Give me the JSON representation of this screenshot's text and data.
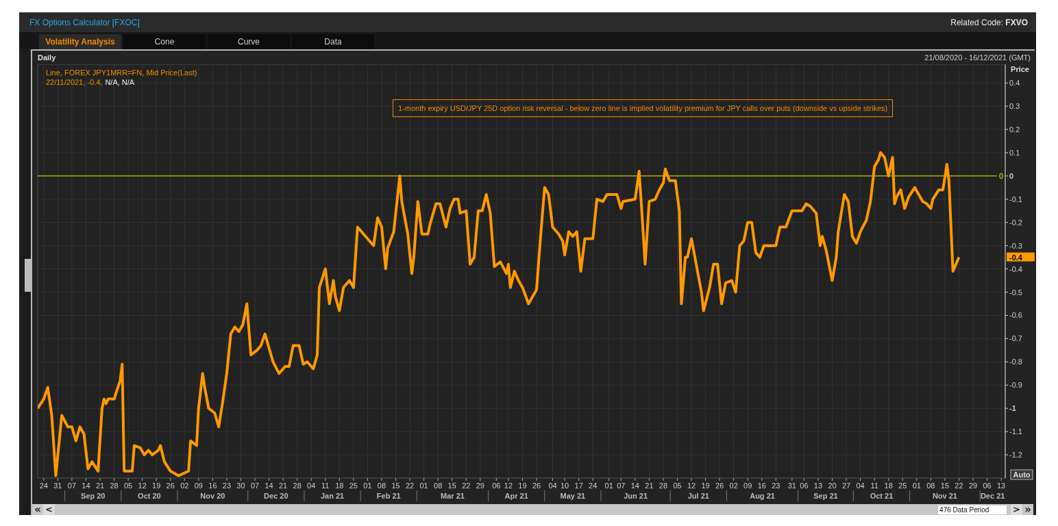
{
  "window": {
    "title": "FX Options Calculator [FXOC]",
    "related_code": "Related Code: **FXVO**"
  },
  "tabs": [
    {
      "label": "Volatility Analysis",
      "selected": true
    },
    {
      "label": "Cone",
      "selected": false
    },
    {
      "label": "Curve",
      "selected": false
    },
    {
      "label": "Data",
      "selected": false
    }
  ],
  "chart_panel": {
    "interval": "Daily",
    "date_range": "21/08/2020 - 16/12/2021 (GMT)",
    "legend": {
      "readout": [
        {
          "kind": "value",
          "text": "22/11/2021, -0.4,"
        },
        {
          "kind": "na",
          "text": "N/A, N/A"
        }
      ]
    },
    "auto_button": "Auto",
    "months": [
      "Sep 20",
      "Oct 20",
      "Nov 20",
      "Dec 20",
      "Jan 21",
      "Feb 21",
      "Mar 21",
      "Apr 21",
      "May 21",
      "Jun 21",
      "Jul 21",
      "Aug 21",
      "Sep 21",
      "Oct 21",
      "Nov 21",
      "Dec 21"
    ],
    "chart_data": {
      "type": "line",
      "ylabel": "Price",
      "x": [
        "2020-08-21",
        "2020-08-24",
        "2020-08-26",
        "2020-08-28",
        "2020-08-30",
        "2020-09-02",
        "2020-09-05",
        "2020-09-07",
        "2020-09-09",
        "2020-09-11",
        "2020-09-13",
        "2020-09-15",
        "2020-09-17",
        "2020-09-20",
        "2020-09-22",
        "2020-09-23",
        "2020-09-24",
        "2020-09-25",
        "2020-09-28",
        "2020-10-01",
        "2020-10-02",
        "2020-10-03",
        "2020-10-07",
        "2020-10-08",
        "2020-10-11",
        "2020-10-13",
        "2020-10-15",
        "2020-10-17",
        "2020-10-20",
        "2020-10-21",
        "2020-10-23",
        "2020-10-26",
        "2020-10-30",
        "2020-11-04",
        "2020-11-05",
        "2020-11-08",
        "2020-11-09",
        "2020-11-11",
        "2020-11-12",
        "2020-11-14",
        "2020-11-17",
        "2020-11-19",
        "2020-11-21",
        "2020-11-23",
        "2020-11-25",
        "2020-11-27",
        "2020-11-29",
        "2020-12-01",
        "2020-12-03",
        "2020-12-05",
        "2020-12-08",
        "2020-12-10",
        "2020-12-12",
        "2020-12-14",
        "2020-12-16",
        "2020-12-19",
        "2020-12-22",
        "2020-12-24",
        "2020-12-26",
        "2020-12-29",
        "2020-12-31",
        "2021-01-02",
        "2021-01-05",
        "2021-01-07",
        "2021-01-08",
        "2021-01-11",
        "2021-01-13",
        "2021-01-15",
        "2021-01-16",
        "2021-01-18",
        "2021-01-20",
        "2021-01-23",
        "2021-01-25",
        "2021-01-27",
        "2021-01-30",
        "2021-02-01",
        "2021-02-04",
        "2021-02-06",
        "2021-02-08",
        "2021-02-10",
        "2021-02-11",
        "2021-02-14",
        "2021-02-17",
        "2021-02-18",
        "2021-02-21",
        "2021-02-23",
        "2021-02-24",
        "2021-02-26",
        "2021-02-28",
        "2021-03-03",
        "2021-03-04",
        "2021-03-07",
        "2021-03-09",
        "2021-03-12",
        "2021-03-14",
        "2021-03-16",
        "2021-03-18",
        "2021-03-19",
        "2021-03-22",
        "2021-03-24",
        "2021-03-26",
        "2021-03-28",
        "2021-03-30",
        "2021-04-01",
        "2021-04-03",
        "2021-04-05",
        "2021-04-08",
        "2021-04-11",
        "2021-04-12",
        "2021-04-13",
        "2021-04-15",
        "2021-04-17",
        "2021-04-19",
        "2021-04-22",
        "2021-04-24",
        "2021-04-26",
        "2021-04-28",
        "2021-04-30",
        "2021-05-02",
        "2021-05-04",
        "2021-05-07",
        "2021-05-09",
        "2021-05-10",
        "2021-05-12",
        "2021-05-14",
        "2021-05-16",
        "2021-05-18",
        "2021-05-20",
        "2021-05-24",
        "2021-05-26",
        "2021-05-29",
        "2021-05-31",
        "2021-06-05",
        "2021-06-07",
        "2021-06-08",
        "2021-06-14",
        "2021-06-16",
        "2021-06-17",
        "2021-06-19",
        "2021-06-21",
        "2021-06-24",
        "2021-06-26",
        "2021-06-28",
        "2021-06-29",
        "2021-07-01",
        "2021-07-04",
        "2021-07-06",
        "2021-07-07",
        "2021-07-09",
        "2021-07-10",
        "2021-07-12",
        "2021-07-15",
        "2021-07-17",
        "2021-07-18",
        "2021-07-21",
        "2021-07-23",
        "2021-07-25",
        "2021-07-27",
        "2021-07-29",
        "2021-08-01",
        "2021-08-03",
        "2021-08-05",
        "2021-08-07",
        "2021-08-09",
        "2021-08-11",
        "2021-08-13",
        "2021-08-15",
        "2021-08-17",
        "2021-08-23",
        "2021-08-25",
        "2021-08-28",
        "2021-08-31",
        "2021-09-05",
        "2021-09-07",
        "2021-09-09",
        "2021-09-12",
        "2021-09-14",
        "2021-09-15",
        "2021-09-17",
        "2021-09-20",
        "2021-09-22",
        "2021-09-23",
        "2021-09-26",
        "2021-09-28",
        "2021-09-30",
        "2021-10-02",
        "2021-10-04",
        "2021-10-07",
        "2021-10-09",
        "2021-10-11",
        "2021-10-13",
        "2021-10-14",
        "2021-10-16",
        "2021-10-18",
        "2021-10-20",
        "2021-10-21",
        "2021-10-22",
        "2021-10-24",
        "2021-10-26",
        "2021-10-28",
        "2021-10-31",
        "2021-11-04",
        "2021-11-06",
        "2021-11-08",
        "2021-11-09",
        "2021-11-12",
        "2021-11-14",
        "2021-11-16",
        "2021-11-17",
        "2021-11-19",
        "2021-11-20",
        "2021-11-22"
      ],
      "series": [
        {
          "name": "Line, FOREX JPY1MRR=FN, Mid Price(Last)",
          "color": "#ff9900",
          "values": [
            -1.0,
            -0.96,
            -0.91,
            -1.03,
            -1.29,
            -1.03,
            -1.08,
            -1.08,
            -1.14,
            -1.08,
            -1.11,
            -1.26,
            -1.23,
            -1.27,
            -1.0,
            -0.96,
            -0.98,
            -0.96,
            -0.96,
            -0.88,
            -0.81,
            -1.27,
            -1.27,
            -1.16,
            -1.17,
            -1.2,
            -1.18,
            -1.2,
            -1.18,
            -1.16,
            -1.23,
            -1.27,
            -1.29,
            -1.27,
            -1.14,
            -1.16,
            -1.0,
            -0.85,
            -0.91,
            -1.0,
            -1.02,
            -1.08,
            -0.97,
            -0.85,
            -0.68,
            -0.65,
            -0.67,
            -0.64,
            -0.55,
            -0.77,
            -0.75,
            -0.73,
            -0.68,
            -0.74,
            -0.8,
            -0.85,
            -0.82,
            -0.82,
            -0.73,
            -0.73,
            -0.81,
            -0.8,
            -0.83,
            -0.77,
            -0.48,
            -0.4,
            -0.55,
            -0.45,
            -0.52,
            -0.58,
            -0.48,
            -0.45,
            -0.48,
            -0.22,
            -0.25,
            -0.27,
            -0.3,
            -0.18,
            -0.22,
            -0.4,
            -0.31,
            -0.24,
            0.0,
            -0.11,
            -0.25,
            -0.42,
            -0.35,
            -0.11,
            -0.25,
            -0.25,
            -0.21,
            -0.12,
            -0.12,
            -0.22,
            -0.14,
            -0.1,
            -0.1,
            -0.16,
            -0.15,
            -0.38,
            -0.35,
            -0.15,
            -0.15,
            -0.08,
            -0.16,
            -0.39,
            -0.37,
            -0.42,
            -0.38,
            -0.48,
            -0.41,
            -0.45,
            -0.48,
            -0.55,
            -0.52,
            -0.49,
            -0.26,
            -0.05,
            -0.08,
            -0.22,
            -0.25,
            -0.28,
            -0.34,
            -0.24,
            -0.26,
            -0.24,
            -0.41,
            -0.27,
            -0.27,
            -0.1,
            -0.11,
            -0.08,
            -0.08,
            -0.14,
            -0.11,
            -0.1,
            0.02,
            -0.11,
            -0.38,
            -0.11,
            -0.1,
            -0.06,
            -0.03,
            0.03,
            -0.02,
            -0.02,
            -0.15,
            -0.55,
            -0.35,
            -0.35,
            -0.27,
            -0.41,
            -0.5,
            -0.58,
            -0.48,
            -0.38,
            -0.38,
            -0.55,
            -0.46,
            -0.45,
            -0.5,
            -0.3,
            -0.28,
            -0.2,
            -0.2,
            -0.33,
            -0.35,
            -0.3,
            -0.3,
            -0.22,
            -0.22,
            -0.15,
            -0.15,
            -0.12,
            -0.13,
            -0.16,
            -0.3,
            -0.26,
            -0.32,
            -0.45,
            -0.35,
            -0.24,
            -0.08,
            -0.11,
            -0.26,
            -0.29,
            -0.24,
            -0.19,
            -0.11,
            0.04,
            0.07,
            0.1,
            0.08,
            0.0,
            0.08,
            -0.12,
            -0.09,
            -0.06,
            -0.14,
            -0.09,
            -0.05,
            -0.11,
            -0.12,
            -0.14,
            -0.1,
            -0.06,
            -0.06,
            0.05,
            -0.02,
            -0.41,
            -0.39,
            -0.35
          ]
        }
      ],
      "xlim": [
        "2020-08-21",
        "2021-12-15"
      ],
      "ylim": [
        -1.3,
        0.48
      ],
      "xticks": [
        {
          "value": "2020-08-24",
          "label": "24"
        },
        {
          "value": "2020-08-31",
          "label": "31"
        },
        {
          "value": "2020-09-07",
          "label": "07"
        },
        {
          "value": "2020-09-14",
          "label": "14"
        },
        {
          "value": "2020-09-21",
          "label": "21"
        },
        {
          "value": "2020-09-28",
          "label": "28"
        },
        {
          "value": "2020-10-05",
          "label": "05"
        },
        {
          "value": "2020-10-12",
          "label": "12"
        },
        {
          "value": "2020-10-19",
          "label": "19"
        },
        {
          "value": "2020-10-26",
          "label": "26"
        },
        {
          "value": "2020-11-02",
          "label": "02"
        },
        {
          "value": "2020-11-09",
          "label": "09"
        },
        {
          "value": "2020-11-16",
          "label": "16"
        },
        {
          "value": "2020-11-23",
          "label": "23"
        },
        {
          "value": "2020-11-30",
          "label": "30"
        },
        {
          "value": "2020-12-07",
          "label": "07"
        },
        {
          "value": "2020-12-14",
          "label": "14"
        },
        {
          "value": "2020-12-21",
          "label": "21"
        },
        {
          "value": "2020-12-28",
          "label": "28"
        },
        {
          "value": "2021-01-04",
          "label": "04"
        },
        {
          "value": "2021-01-11",
          "label": "11"
        },
        {
          "value": "2021-01-18",
          "label": "18"
        },
        {
          "value": "2021-01-25",
          "label": "25"
        },
        {
          "value": "2021-02-01",
          "label": "01"
        },
        {
          "value": "2021-02-08",
          "label": "08"
        },
        {
          "value": "2021-02-15",
          "label": "15"
        },
        {
          "value": "2021-02-22",
          "label": "22"
        },
        {
          "value": "2021-03-01",
          "label": "01"
        },
        {
          "value": "2021-03-08",
          "label": "08"
        },
        {
          "value": "2021-03-15",
          "label": "15"
        },
        {
          "value": "2021-03-22",
          "label": "22"
        },
        {
          "value": "2021-03-29",
          "label": "29"
        },
        {
          "value": "2021-04-06",
          "label": "06"
        },
        {
          "value": "2021-04-12",
          "label": "12"
        },
        {
          "value": "2021-04-19",
          "label": "19"
        },
        {
          "value": "2021-04-26",
          "label": "26"
        },
        {
          "value": "2021-05-04",
          "label": "04"
        },
        {
          "value": "2021-05-10",
          "label": "10"
        },
        {
          "value": "2021-05-17",
          "label": "17"
        },
        {
          "value": "2021-05-24",
          "label": "24"
        },
        {
          "value": "2021-06-01",
          "label": "01"
        },
        {
          "value": "2021-06-07",
          "label": "07"
        },
        {
          "value": "2021-06-14",
          "label": "14"
        },
        {
          "value": "2021-06-21",
          "label": "21"
        },
        {
          "value": "2021-06-28",
          "label": "28"
        },
        {
          "value": "2021-07-05",
          "label": "05"
        },
        {
          "value": "2021-07-12",
          "label": "12"
        },
        {
          "value": "2021-07-19",
          "label": "19"
        },
        {
          "value": "2021-07-26",
          "label": "26"
        },
        {
          "value": "2021-08-02",
          "label": "02"
        },
        {
          "value": "2021-08-09",
          "label": "09"
        },
        {
          "value": "2021-08-16",
          "label": "16"
        },
        {
          "value": "2021-08-23",
          "label": "23"
        },
        {
          "value": "2021-08-31",
          "label": "31"
        },
        {
          "value": "2021-09-06",
          "label": "06"
        },
        {
          "value": "2021-09-13",
          "label": "13"
        },
        {
          "value": "2021-09-20",
          "label": "20"
        },
        {
          "value": "2021-09-27",
          "label": "27"
        },
        {
          "value": "2021-10-04",
          "label": "04"
        },
        {
          "value": "2021-10-11",
          "label": "11"
        },
        {
          "value": "2021-10-18",
          "label": "18"
        },
        {
          "value": "2021-10-25",
          "label": "25"
        },
        {
          "value": "2021-11-01",
          "label": "01"
        },
        {
          "value": "2021-11-08",
          "label": "08"
        },
        {
          "value": "2021-11-15",
          "label": "15"
        },
        {
          "value": "2021-11-22",
          "label": "22"
        },
        {
          "value": "2021-11-29",
          "label": "29"
        },
        {
          "value": "2021-12-06",
          "label": "06"
        },
        {
          "value": "2021-12-13",
          "label": "13"
        }
      ],
      "yticks": [
        0.4,
        0.3,
        0.2,
        0.1,
        0,
        -0.1,
        -0.2,
        -0.3,
        -0.4,
        -0.5,
        -0.6,
        -0.7,
        -0.8,
        -0.9,
        -1,
        -1.1,
        -1.2
      ],
      "grid": true,
      "ref_lines": [
        {
          "axis": "y",
          "value": 0,
          "label": "0",
          "color": "#e8e800"
        }
      ],
      "annotations": [
        "1-month expiry USD/JPY 25D option risk reversal  - below zero line is implied volatility premium for JPY calls over puts (downside vs upside strikes)"
      ]
    },
    "last_value_tag": "-0.4"
  },
  "scrollbar": {
    "first": "«",
    "prev": "<",
    "data_period": "476 Data Period",
    "next": ">",
    "last": "»"
  }
}
